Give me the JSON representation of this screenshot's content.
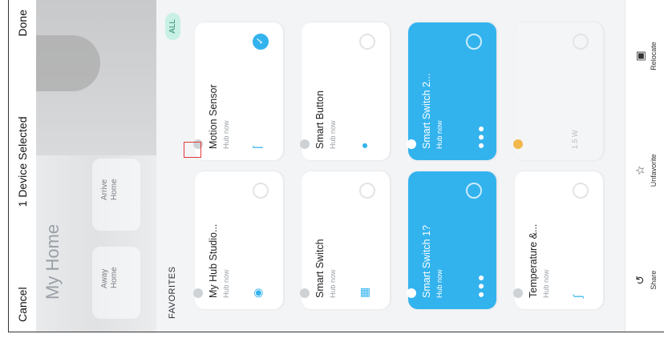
{
  "topbar": {
    "cancel": "Cancel",
    "title": "1 Device Selected",
    "done": "Done"
  },
  "hero": {
    "title": "My Home",
    "chips": [
      "Away Home",
      "Arrive Home"
    ]
  },
  "favorites": {
    "label": "FAVORITES",
    "all": "ALL"
  },
  "devices": [
    {
      "name": "My Hub Studio...",
      "status": "Hub now",
      "selected": false,
      "style": "white",
      "icon": "hub-icon"
    },
    {
      "name": "Motion Sensor",
      "status": "Hub now",
      "selected": true,
      "style": "white",
      "icon": "sensor-icon"
    },
    {
      "name": "Smart Switch",
      "status": "Hub now",
      "selected": false,
      "style": "white",
      "icon": "switch-icon"
    },
    {
      "name": "Smart Button",
      "status": "Hub now",
      "selected": false,
      "style": "white",
      "icon": "button-icon"
    },
    {
      "name": "Smart Switch 1?",
      "status": "Hub now",
      "selected": false,
      "style": "blue",
      "icon": "switch-icon"
    },
    {
      "name": "Smart Switch 2...",
      "status": "Hub now",
      "selected": false,
      "style": "blue",
      "icon": "switch-icon"
    },
    {
      "name": "Temperature &...",
      "status": "Hub now",
      "selected": false,
      "style": "white",
      "icon": "thermometer-icon"
    },
    {
      "name": "",
      "status": "1.5 W",
      "selected": false,
      "style": "faded",
      "icon": "plug-icon"
    }
  ],
  "actions": [
    {
      "label": "Share",
      "icon": "share-icon"
    },
    {
      "label": "Unfavorite",
      "icon": "star-icon"
    },
    {
      "label": "Relocate",
      "icon": "relocate-icon"
    }
  ],
  "colors": {
    "accent": "#33b3ee",
    "fav_chip": "#c8f0e4"
  }
}
